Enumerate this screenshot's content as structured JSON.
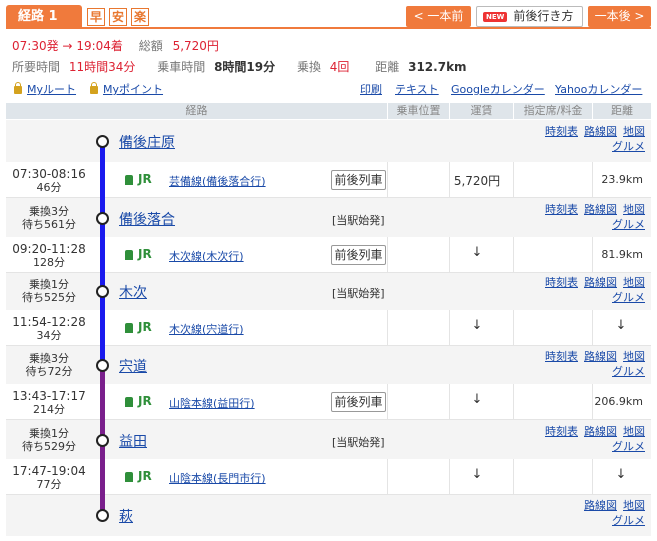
{
  "header": {
    "tab_label": "経路 1",
    "tags": [
      "早",
      "安",
      "楽"
    ],
    "prev_button": "< 一本前",
    "new_badge": "NEW",
    "both_button": "前後行き方",
    "next_button": "一本後 >"
  },
  "summary": {
    "dep": "07:30発",
    "arrow": "→",
    "arr": "19:04着",
    "fare_label": "総額",
    "fare": "5,720円",
    "duration_label": "所要時間",
    "duration": "11時間34分",
    "ride_label": "乗車時間",
    "ride": "8時間19分",
    "transfer_label": "乗換",
    "transfers": "4回",
    "distance_label": "距離",
    "distance": "312.7km"
  },
  "links": {
    "my_route": "Myルート",
    "my_point": "Myポイント",
    "print": "印刷",
    "text": "テキスト",
    "google": "Googleカレンダー",
    "yahoo": "Yahooカレンダー"
  },
  "table_header": [
    "経路",
    "乗車位置",
    "運賃",
    "指定席/料金",
    "距離"
  ],
  "station_links": {
    "timetable": "時刻表",
    "route_map": "路線図",
    "map": "地図",
    "gourmet": "グルメ"
  },
  "stations": [
    {
      "name": "備後庄原",
      "transfer1": "",
      "transfer2": "",
      "origin": "",
      "timetable": true
    },
    {
      "name": "備後落合",
      "transfer1": "乗換3分",
      "transfer2": "待ち561分",
      "origin": "[当駅始発]",
      "timetable": true
    },
    {
      "name": "木次",
      "transfer1": "乗換1分",
      "transfer2": "待ち525分",
      "origin": "[当駅始発]",
      "timetable": true
    },
    {
      "name": "宍道",
      "transfer1": "乗換3分",
      "transfer2": "待ち72分",
      "origin": "",
      "timetable": true
    },
    {
      "name": "益田",
      "transfer1": "乗換1分",
      "transfer2": "待ち529分",
      "origin": "[当駅始発]",
      "timetable": true
    },
    {
      "name": "萩",
      "transfer1": "",
      "transfer2": "",
      "origin": "",
      "timetable": false
    }
  ],
  "segments": [
    {
      "time": "07:30-08:16",
      "dur": "46分",
      "company": "JR",
      "line": "芸備線(備後落合行)",
      "button": "前後列車",
      "fare": "5,720円",
      "dist": "23.9km",
      "color": "#1a1aee"
    },
    {
      "time": "09:20-11:28",
      "dur": "128分",
      "company": "JR",
      "line": "木次線(木次行)",
      "button": "前後列車",
      "fare": "↓",
      "dist": "81.9km",
      "color": "#1a1aee"
    },
    {
      "time": "11:54-12:28",
      "dur": "34分",
      "company": "JR",
      "line": "木次線(宍道行)",
      "button": "",
      "fare": "↓",
      "dist": "↓",
      "color": "#1a1aee"
    },
    {
      "time": "13:43-17:17",
      "dur": "214分",
      "company": "JR",
      "line": "山陰本線(益田行)",
      "button": "前後列車",
      "fare": "↓",
      "dist": "206.9km",
      "color": "#7a1f8c"
    },
    {
      "time": "17:47-19:04",
      "dur": "77分",
      "company": "JR",
      "line": "山陰本線(長門市行)",
      "button": "",
      "fare": "↓",
      "dist": "↓",
      "color": "#7a1f8c"
    }
  ]
}
